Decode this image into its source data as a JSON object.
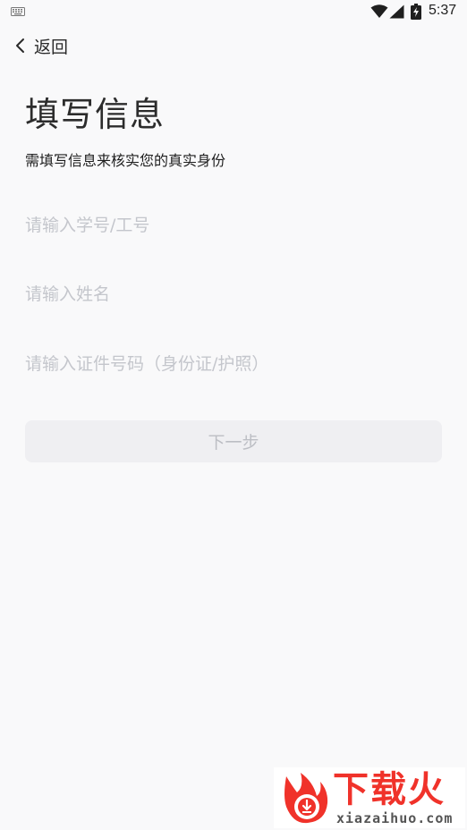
{
  "status_bar": {
    "time": "5:37",
    "icons": [
      "keyboard-icon",
      "wifi-icon",
      "signal-icon",
      "battery-charging-icon"
    ]
  },
  "nav": {
    "back_label": "返回",
    "back_icon": "chevron-left-icon"
  },
  "header": {
    "title": "填写信息",
    "subtitle": "需填写信息来核实您的真实身份"
  },
  "form": {
    "student_id_placeholder": "请输入学号/工号",
    "name_placeholder": "请输入姓名",
    "id_number_placeholder": "请输入证件号码（身份证/护照）",
    "student_id_value": "",
    "name_value": "",
    "id_number_value": "",
    "next_label": "下一步"
  },
  "watermark": {
    "brand": "下载火",
    "url": "xiazaihuo.com"
  },
  "colors": {
    "background": "#f9f9fa",
    "placeholder": "#c4c6cc",
    "button_disabled_bg": "#efeff2",
    "button_disabled_text": "#bcbec4",
    "watermark_red": "#f0322a"
  }
}
